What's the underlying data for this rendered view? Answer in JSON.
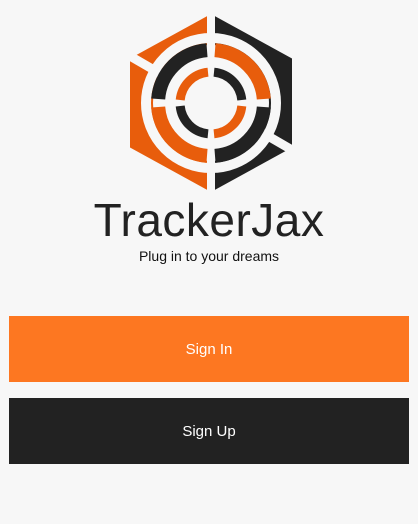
{
  "app": {
    "title": "TrackerJax",
    "tagline": "Plug in to your dreams"
  },
  "actions": {
    "sign_in_label": "Sign In",
    "sign_up_label": "Sign Up"
  },
  "colors": {
    "brand_orange": "#fd7721",
    "logo_orange": "#e85d0c",
    "dark": "#222222",
    "background": "#f7f7f7"
  },
  "icons": {
    "logo": "trackerjax-hexagon-target-logo"
  }
}
